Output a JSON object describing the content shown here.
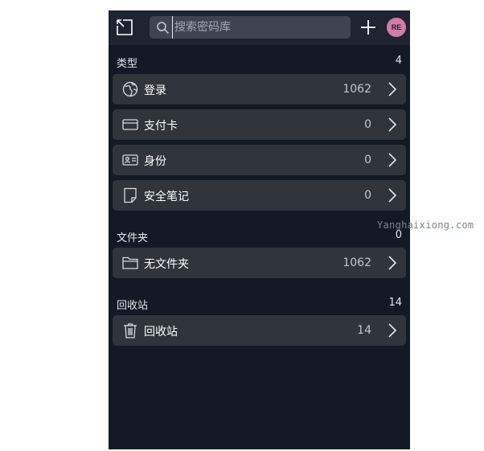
{
  "search": {
    "placeholder": "搜索密码库"
  },
  "avatar": {
    "initials": "RE",
    "color": "#d57ba7"
  },
  "types": {
    "title": "类型",
    "count": "4",
    "items": [
      {
        "label": "登录",
        "count": "1062",
        "icon": "globe-icon"
      },
      {
        "label": "支付卡",
        "count": "0",
        "icon": "credit-card-icon"
      },
      {
        "label": "身份",
        "count": "0",
        "icon": "id-card-icon"
      },
      {
        "label": "安全笔记",
        "count": "0",
        "icon": "note-icon"
      }
    ]
  },
  "folders": {
    "title": "文件夹",
    "count": "0",
    "items": [
      {
        "label": "无文件夹",
        "count": "1062",
        "icon": "folder-icon"
      }
    ]
  },
  "trash": {
    "title": "回收站",
    "count": "14",
    "items": [
      {
        "label": "回收站",
        "count": "14",
        "icon": "trash-icon"
      }
    ]
  },
  "watermark": "Yanghaixiong.com",
  "colors": {
    "background": "#131a25",
    "header": "#1e2430",
    "row": "#2f343d",
    "search": "#3e4452"
  }
}
